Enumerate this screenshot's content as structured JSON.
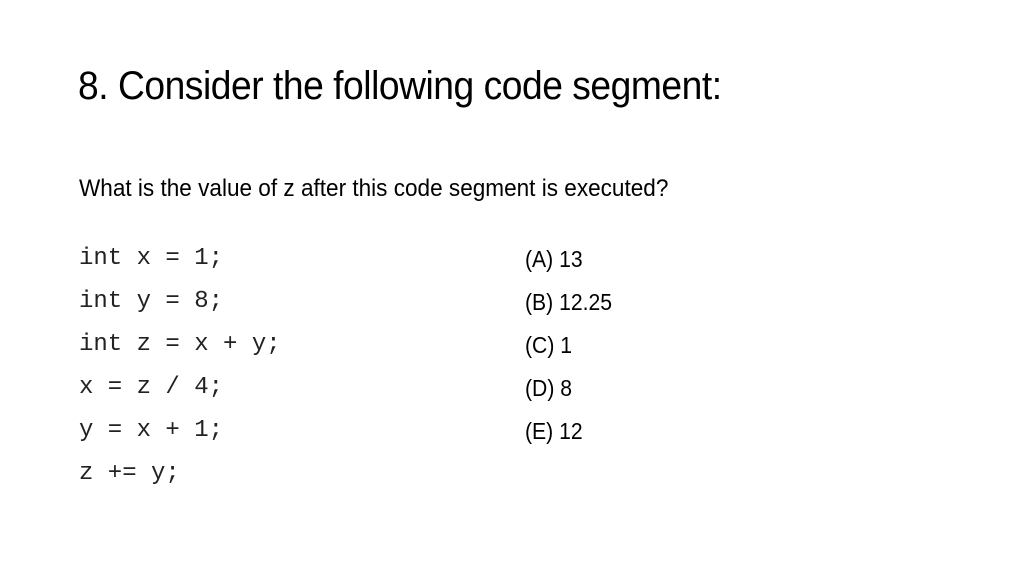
{
  "slide": {
    "title": "8. Consider the following code segment:",
    "question": "What is the value of z after this code segment is executed?",
    "code_lines": [
      "int x = 1;",
      "int y = 8;",
      "int z = x + y;",
      "x = z / 4;",
      "y = x + 1;",
      "z += y;"
    ],
    "choices": [
      "(A) 13",
      "(B) 12.25",
      "(C) 1",
      "(D) 8",
      "(E) 12"
    ]
  }
}
